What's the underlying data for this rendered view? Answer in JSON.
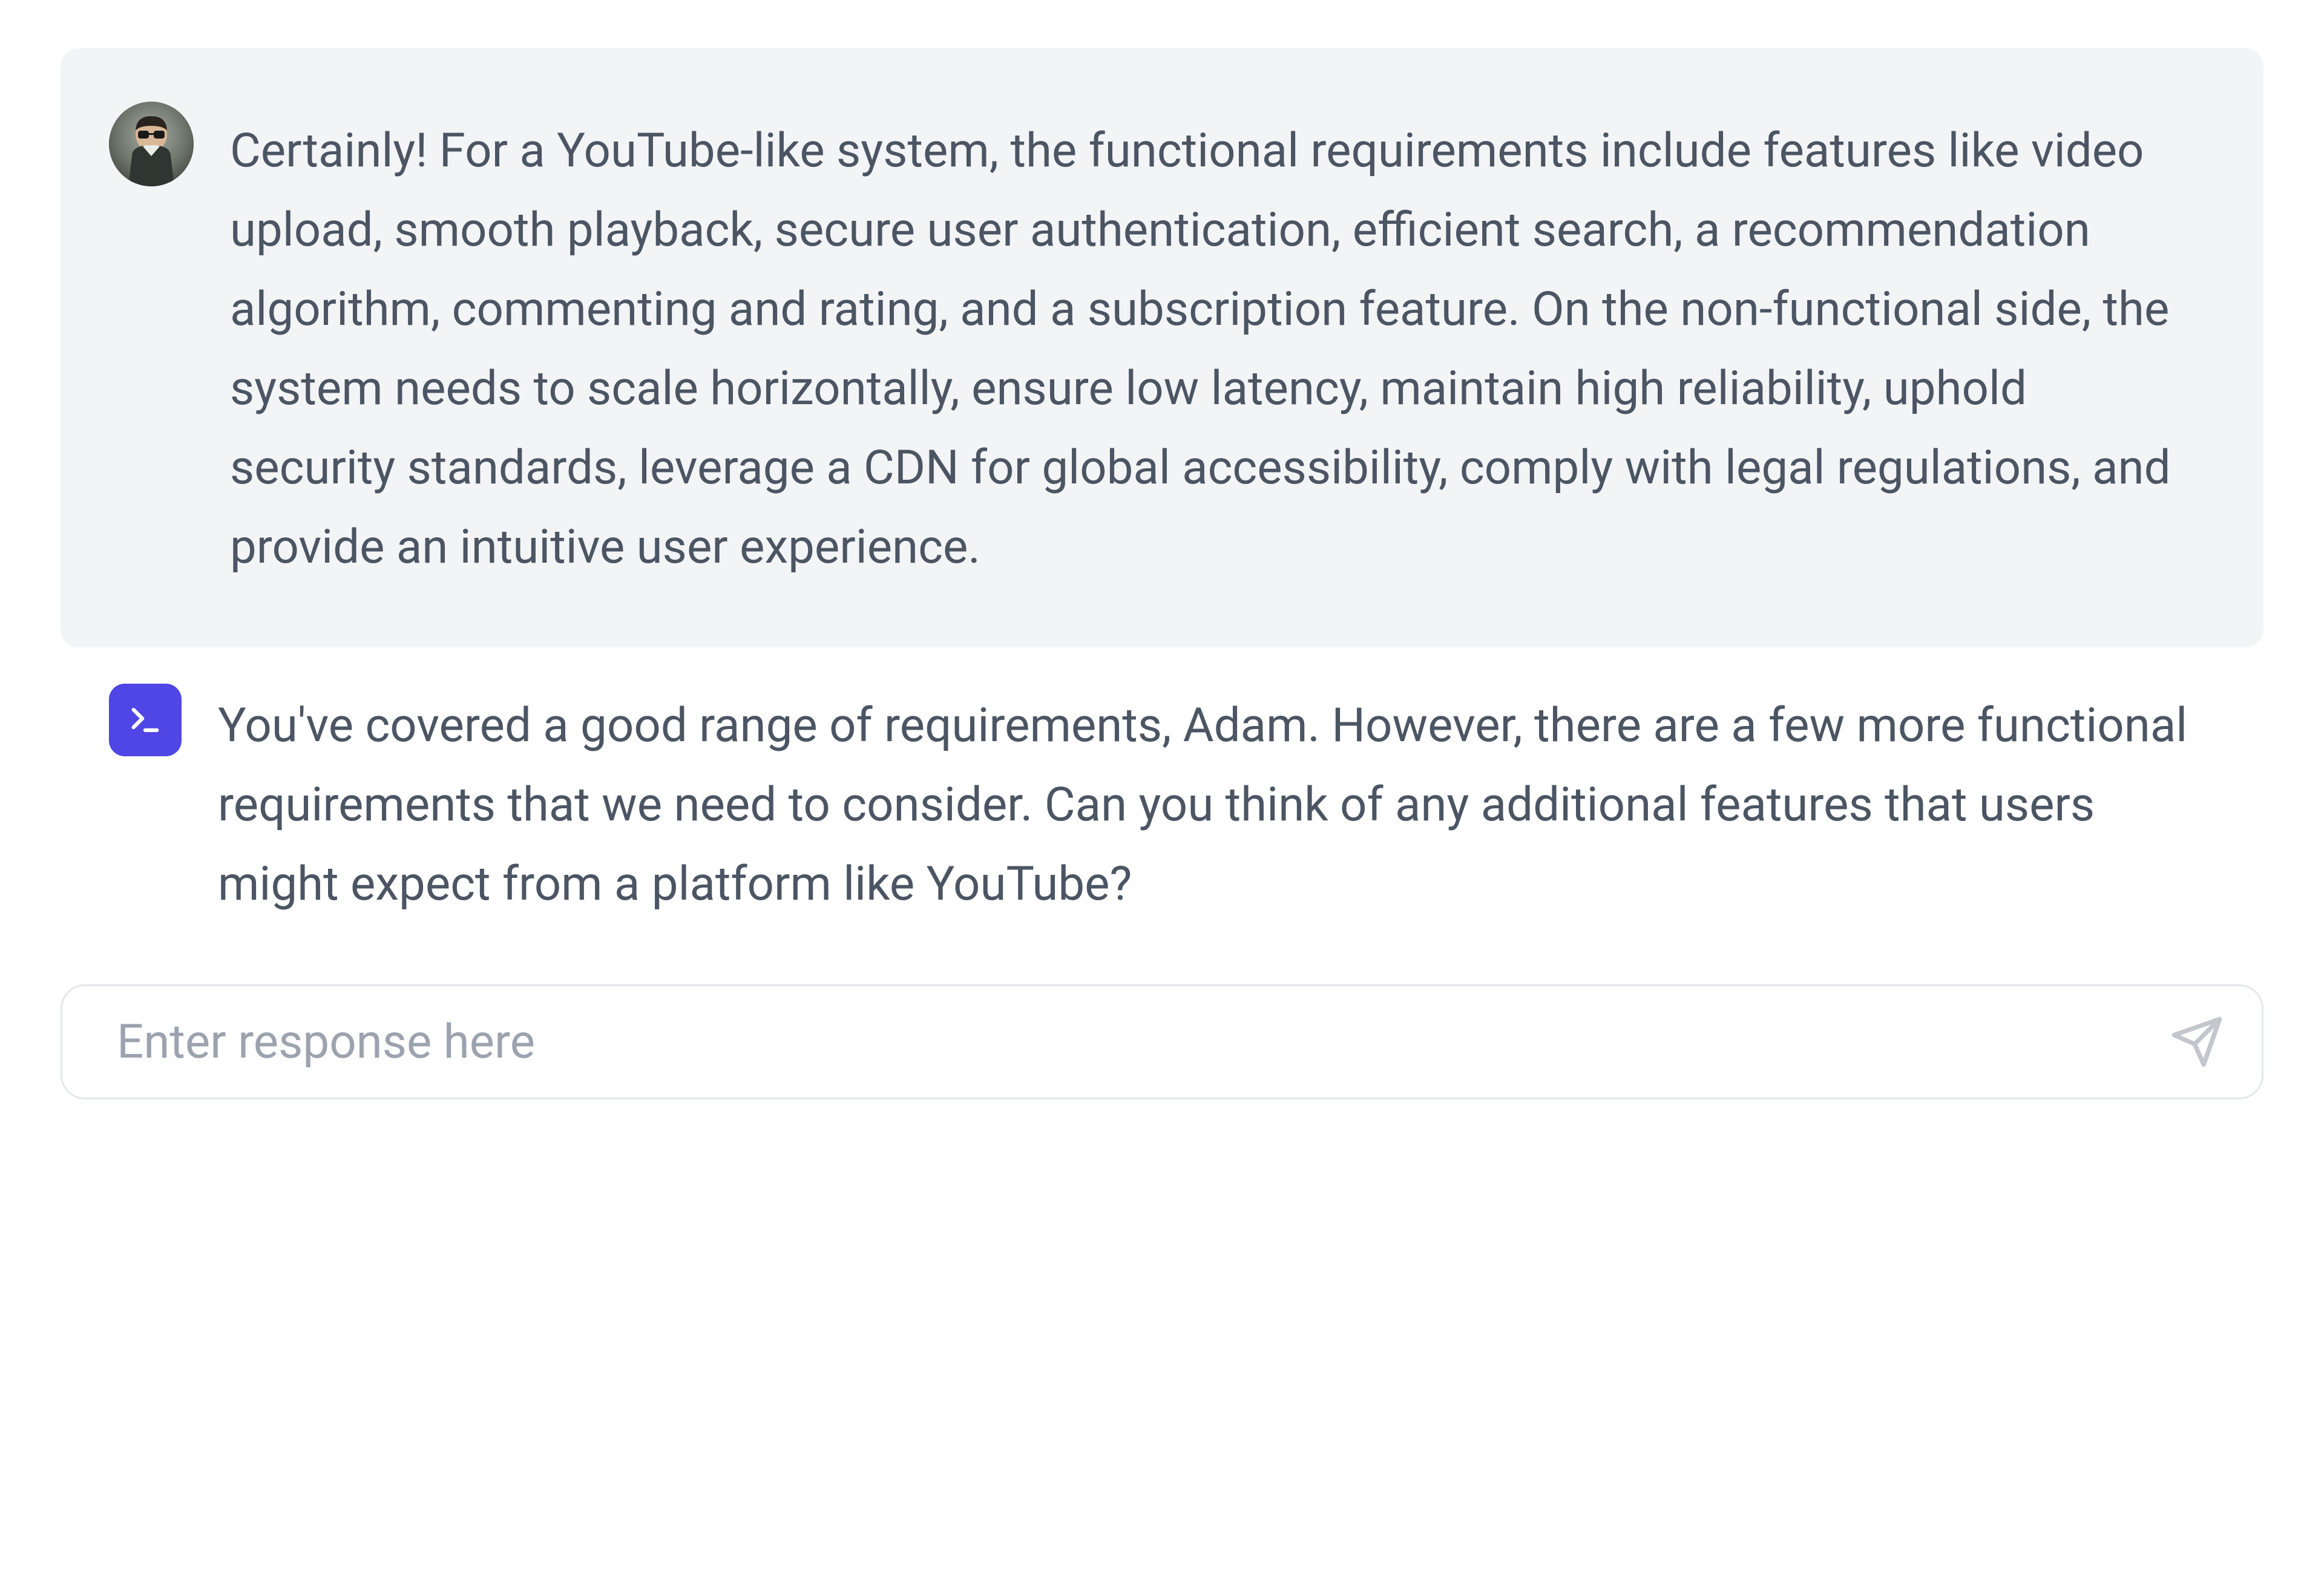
{
  "messages": [
    {
      "role": "user",
      "text": "Certainly! For a YouTube-like system, the functional requirements include features like video upload, smooth playback, secure user authentication, efficient search, a recommendation algorithm, commenting and rating, and a subscription feature. On the non-functional side, the system needs to scale horizontally, ensure low latency, maintain high reliability, uphold security standards, leverage a CDN for global accessibility, comply with legal regulations, and provide an intuitive user experience."
    },
    {
      "role": "bot",
      "text": "You've covered a good range of requirements, Adam. However, there are a few more functional requirements that we need to consider. Can you think of any additional features that users might expect from a platform like YouTube?"
    }
  ],
  "input": {
    "placeholder": "Enter response here"
  },
  "colors": {
    "bot_avatar_bg": "#4f46e5",
    "text": "#4b5563",
    "placeholder": "#9ca3af",
    "border": "#e5e7eb",
    "card_bg": "#f3f4f6",
    "send_icon": "#c3c6cc"
  }
}
